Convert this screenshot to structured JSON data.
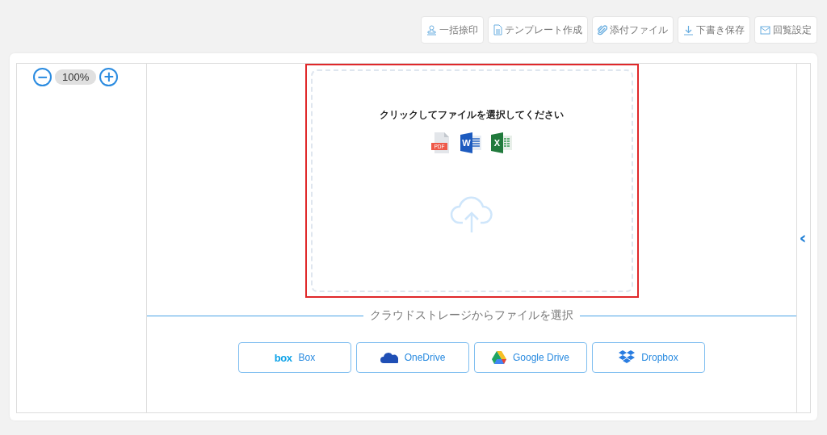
{
  "toolbar": [
    {
      "kind": "stamp",
      "label": "一括捺印"
    },
    {
      "kind": "document",
      "label": "テンプレート作成"
    },
    {
      "kind": "clip",
      "label": "添付ファイル"
    },
    {
      "kind": "download",
      "label": "下書き保存"
    },
    {
      "kind": "mail",
      "label": "回覧設定"
    }
  ],
  "zoom": {
    "minus": "−",
    "value": "100%",
    "plus": "+"
  },
  "dropzone": {
    "prompt": "クリックしてファイルを選択してください",
    "types": [
      {
        "kind": "pdf",
        "mark": "PDF"
      },
      {
        "kind": "word",
        "mark": "W"
      },
      {
        "kind": "excel",
        "mark": "X"
      }
    ]
  },
  "cloud": {
    "heading": "クラウドストレージからファイルを選択",
    "services": [
      {
        "kind": "box",
        "label": "Box",
        "logo": "box"
      },
      {
        "kind": "onedrive",
        "label": "OneDrive"
      },
      {
        "kind": "gdrive",
        "label": "Google Drive"
      },
      {
        "kind": "dropbox",
        "label": "Dropbox"
      }
    ]
  },
  "side_toggle": "‹"
}
